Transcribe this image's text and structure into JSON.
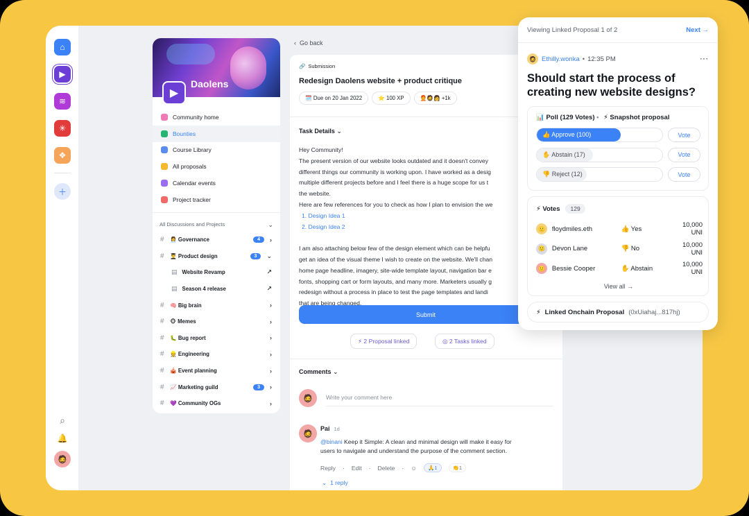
{
  "community": {
    "name": "Daolens"
  },
  "nav": [
    {
      "label": "Community home",
      "color": "#f07ab5"
    },
    {
      "label": "Bounties",
      "color": "#22b573"
    },
    {
      "label": "Course Library",
      "color": "#5b8def"
    },
    {
      "label": "All proposals",
      "color": "#f5b82e"
    },
    {
      "label": "Calendar events",
      "color": "#9b6df0"
    },
    {
      "label": "Project tracker",
      "color": "#f06a6a"
    }
  ],
  "discussions": {
    "header": "All Discussions and Projects",
    "items": [
      {
        "label": "👩‍💼 Governance",
        "badge": "4"
      },
      {
        "label": "👨‍🎓 Product design",
        "badge": "3"
      },
      {
        "label": "Website Revamp",
        "sub": true
      },
      {
        "label": "Season 4 release",
        "sub": true
      },
      {
        "label": "🧠 Big brain"
      },
      {
        "label": "🐵 Memes"
      },
      {
        "label": "🐛 Bug report"
      },
      {
        "label": "👷 Engineering"
      },
      {
        "label": "🎪 Event planning"
      },
      {
        "label": "📈 Marketing guild",
        "badge": "3"
      },
      {
        "label": "💜 Community OGs"
      }
    ]
  },
  "main": {
    "go_back": "Go back",
    "tag": "Submission",
    "title": "Redesign Daolens website + product critique",
    "due": "🗓️ Due on 20 Jan 2022",
    "xp": "⭐ 100 XP",
    "participants": "+1k",
    "task_details": "Task Details",
    "body": [
      "Hey Community!",
      "The present version of our website looks outdated and it doesn't convey",
      "different things our community is working upon. I have worked as a desig",
      "multiple different projects before and I feel there is a huge scope for us t",
      "the website.",
      "Here are few references for you to check as how I plan to envision the we"
    ],
    "links": [
      "1. Design Idea 1",
      "2. Design Idea 2"
    ],
    "body2": [
      "I am also attaching below few of the design element which can be helpfu",
      "get an idea of the visual theme I wish to create on the website. We'll chan",
      "home page headline, imagery, site-wide template layout, navigation bar e",
      "fonts, shopping cart or form layouts, and many more. Marketers usually g",
      "redesign without a process in place to test the page templates and landi",
      "that are being changed."
    ],
    "submit": "Submit",
    "proposal_linked": "2 Proposal linked",
    "tasks_linked": "2 Tasks linked",
    "comments": "Comments",
    "comment_placeholder": "Write your comment here",
    "comment": {
      "author": "Pai",
      "time": "1d",
      "mention": "@binani",
      "text1": " Keep it Simple: A clean and minimal design will make it easy for",
      "text2": "users to navigate and understand the purpose of the comment section.",
      "reply": "Reply",
      "edit": "Edit",
      "delete": "Delete",
      "react1": "🙏1",
      "react2": "👏1",
      "replies": "1 reply"
    }
  },
  "popup": {
    "viewing": "Viewing Linked Proposal 1 of 2",
    "next": "Next →",
    "author": "Ethilly.wonka",
    "time": "12:35 PM",
    "question": "Should start the process of creating new website designs?",
    "poll_title": "Poll (129 Votes)",
    "snapshot": "⚡ Snapshot proposal",
    "options": [
      {
        "label": "👍 Approve (100)",
        "fraction": 0.67,
        "color": "#3b82f6",
        "text_color": "#ffffff"
      },
      {
        "label": "✋ Abstain (17)",
        "fraction": 0.45,
        "color": "#eef0f3",
        "text_color": "#4a4f59"
      },
      {
        "label": "👎 Reject (12)",
        "fraction": 0.4,
        "color": "#eef0f3",
        "text_color": "#4a4f59"
      }
    ],
    "vote_label": "Vote",
    "votes_title": "Votes",
    "votes_count": "129",
    "voters": [
      {
        "name": "floydmiles.eth",
        "choice": "👍 Yes",
        "amount": "10,000 UNI"
      },
      {
        "name": "Devon Lane",
        "choice": "👎 No",
        "amount": "10,000 UNI"
      },
      {
        "name": "Bessie Cooper",
        "choice": "✋ Abstain",
        "amount": "10,000 UNI"
      }
    ],
    "view_all": "View all →",
    "linked_onchain": "Linked Onchain Proposal",
    "onchain_hash": "(0xUiahaj...817hj)"
  }
}
